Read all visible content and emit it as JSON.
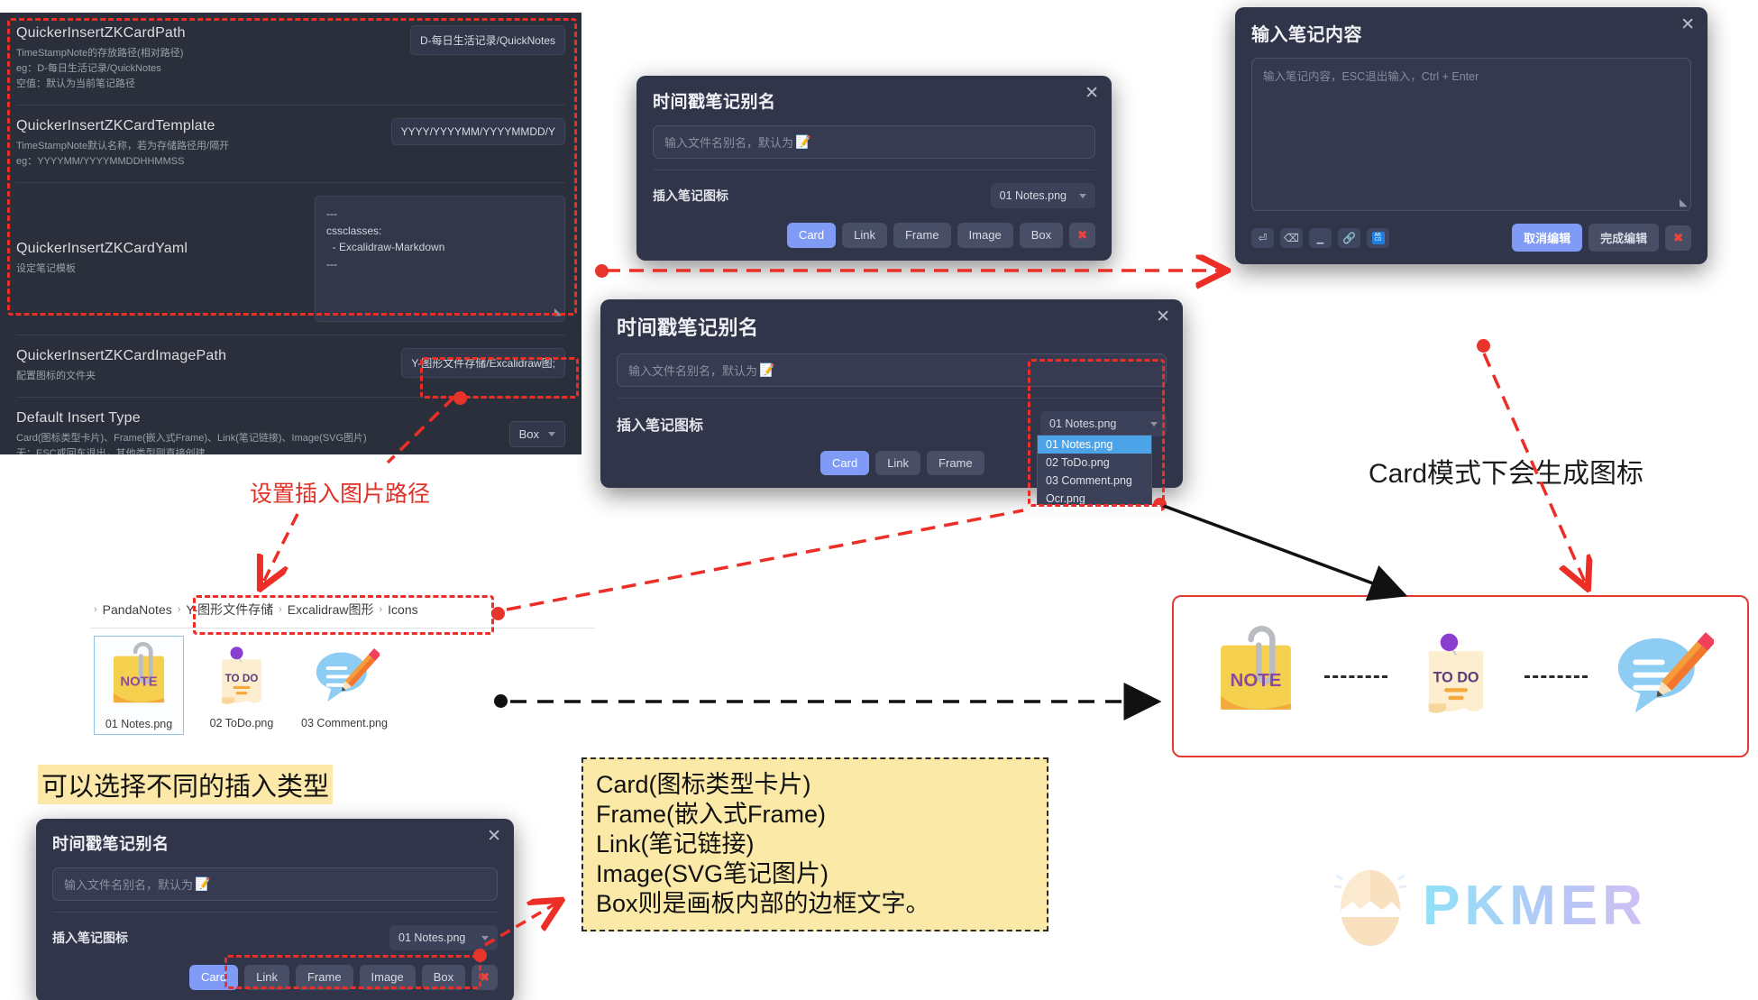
{
  "settings_panel": {
    "rows": [
      {
        "name": "QuickerInsertZKCardPath",
        "desc_lines": [
          "TimeStampNote的存放路径(相对路径)",
          "eg：D-每日生活记录/QuickNotes",
          "空值：默认为当前笔记路径"
        ],
        "value": "D-每日生活记录/QuickNotes"
      },
      {
        "name": "QuickerInsertZKCardTemplate",
        "desc_lines": [
          "TimeStampNote默认名称，若为存储路径用/隔开",
          "eg：YYYYMM/YYYYMMDDHHMMSS"
        ],
        "value": "YYYY/YYYYMM/YYYYMMDD/Y"
      },
      {
        "name": "QuickerInsertZKCardYaml",
        "desc_lines": [
          "设定笔记模板"
        ],
        "yaml": "---\ncssclasses:\n  - Excalidraw-Markdown\n---"
      },
      {
        "name": "QuickerInsertZKCardImagePath",
        "desc_lines": [
          "配置图标的文件夹"
        ],
        "value": "Y-图形文件存储/Excalidraw图;"
      },
      {
        "name": "Default Insert Type",
        "desc_lines": [
          "Card(图标类型卡片)、Frame(嵌入式Frame)、Link(笔记链接)、Image(SVG图片)",
          "无：ESC或回车退出，其他类型则直接创建"
        ],
        "select_value": "Box"
      }
    ]
  },
  "dialog_top": {
    "title": "时间戳笔记别名",
    "close": "✕",
    "input_placeholder": "输入文件名别名，默认为",
    "field_label": "插入笔记图标",
    "select_value": "01 Notes.png",
    "buttons": [
      "Card",
      "Link",
      "Frame",
      "Image",
      "Box"
    ],
    "close_action": "✖"
  },
  "dialog_mid": {
    "title": "时间戳笔记别名",
    "close": "✕",
    "input_placeholder": "输入文件名别名，默认为",
    "field_label": "插入笔记图标",
    "select_value": "01 Notes.png",
    "dropdown_options": [
      "01 Notes.png",
      "02 ToDo.png",
      "03 Comment.png",
      "Ocr.png"
    ],
    "dropdown_selected_index": 0,
    "buttons": [
      "Card",
      "Link",
      "Frame"
    ]
  },
  "dialog_bottom": {
    "title": "时间戳笔记别名",
    "close": "✕",
    "input_placeholder": "输入文件名别名，默认为",
    "field_label": "插入笔记图标",
    "select_value": "01 Notes.png",
    "buttons": [
      "Card",
      "Link",
      "Frame",
      "Image",
      "Box"
    ],
    "close_action": "✖"
  },
  "dialog_note": {
    "title": "输入笔记内容",
    "close": "✕",
    "textarea_placeholder": "输入笔记内容，ESC退出输入，Ctrl + Enter",
    "tools": [
      "enter-key-icon",
      "backspace-icon",
      "space-bar-icon",
      "link-icon",
      "abc-keyboard-icon"
    ],
    "cancel_label": "取消编辑",
    "confirm_label": "完成编辑",
    "close_action": "✖"
  },
  "explorer": {
    "breadcrumb": [
      "PandaNotes",
      "Y-图形文件存储",
      "Excalidraw图形",
      "Icons"
    ],
    "files": [
      {
        "label": "01 Notes.png",
        "icon": "note-sticky-icon",
        "selected": true
      },
      {
        "label": "02 ToDo.png",
        "icon": "todo-pinned-icon",
        "selected": false
      },
      {
        "label": "03 Comment.png",
        "icon": "comment-pencil-icon",
        "selected": false
      }
    ]
  },
  "result_strip": {
    "icons": [
      "note-sticky-icon",
      "todo-pinned-icon",
      "comment-pencil-icon"
    ]
  },
  "annotations": {
    "set_image_path": "设置插入图片路径",
    "card_generates_icon": "Card模式下会生成图标",
    "can_choose_type": "可以选择不同的插入类型",
    "insert_types_note": [
      "Card(图标类型卡片)",
      "Frame(嵌入式Frame)",
      "Link(笔记链接)",
      "Image(SVG笔记图片)",
      "Box则是画板内部的边框文字。"
    ]
  },
  "brand": {
    "name": "PKMER"
  },
  "colors": {
    "accent_blue": "#7f9bf5",
    "annotation_red": "#e03127",
    "highlight_yellow": "#fce8a8",
    "panel_bg": "#2b2f3b",
    "modal_bg": "#31354a",
    "dropdown_sel": "#4da3e8"
  }
}
